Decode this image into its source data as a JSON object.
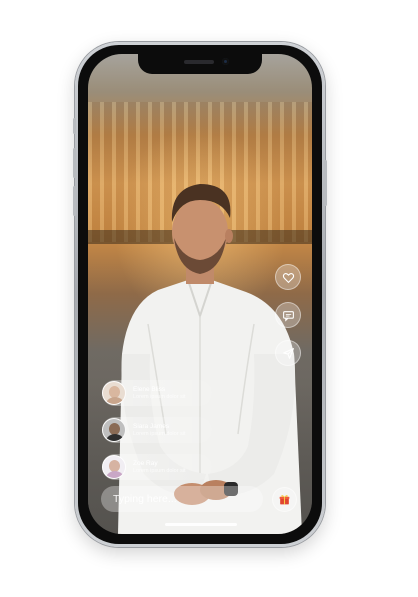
{
  "screen": {
    "type": "live-stream-viewer"
  },
  "side_actions": [
    {
      "icon": "heart-icon"
    },
    {
      "icon": "chat-bubble-icon"
    },
    {
      "icon": "send-icon"
    }
  ],
  "comments": [
    {
      "name": "Elene Bliss",
      "message": "Lorem ipsum dolor sit",
      "avatar_color": "#d9c2b0"
    },
    {
      "name": "Siara James",
      "message": "Lorem ipsum dolor sit",
      "avatar_color": "#3a3a3a"
    },
    {
      "name": "Zoe Ray",
      "message": "Lorem ipsum dolor sit",
      "avatar_color": "#e9e4ec"
    }
  ],
  "input": {
    "placeholder": "Typing here..."
  },
  "gift_button": {
    "icon": "gift-icon",
    "color": "#e0442f"
  },
  "colors": {
    "shirt": "#f2f2f0",
    "overlay": "rgba(255,255,255,0.3)"
  }
}
